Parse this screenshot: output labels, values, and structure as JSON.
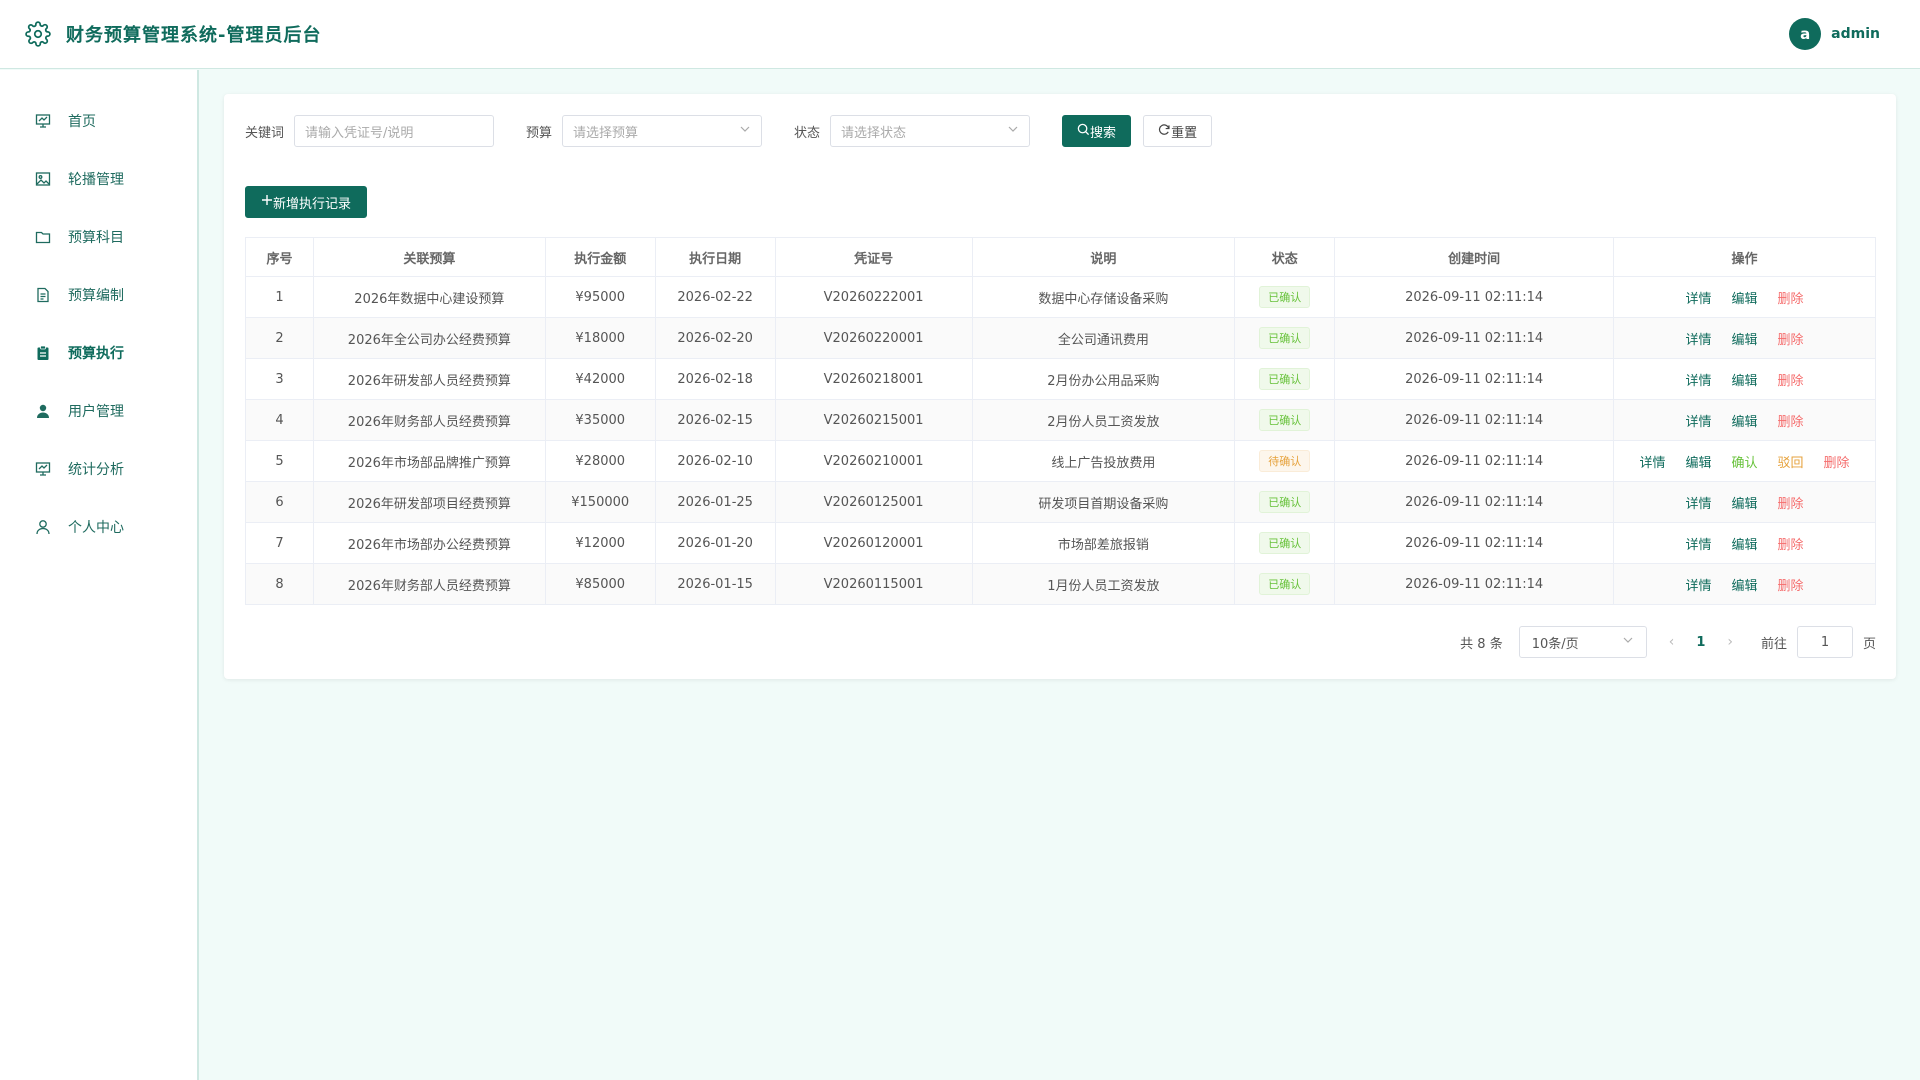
{
  "header": {
    "title": "财务预算管理系统-管理员后台",
    "avatar_letter": "a",
    "username": "admin"
  },
  "sidebar": {
    "items": [
      {
        "label": "首页",
        "icon": "monitor-icon"
      },
      {
        "label": "轮播管理",
        "icon": "image-icon"
      },
      {
        "label": "预算科目",
        "icon": "folder-icon"
      },
      {
        "label": "预算编制",
        "icon": "document-icon"
      },
      {
        "label": "预算执行",
        "icon": "clipboard-icon",
        "active": true
      },
      {
        "label": "用户管理",
        "icon": "user-filled-icon"
      },
      {
        "label": "统计分析",
        "icon": "monitor-icon"
      },
      {
        "label": "个人中心",
        "icon": "user-icon"
      }
    ]
  },
  "filters": {
    "keyword_label": "关键词",
    "keyword_placeholder": "请输入凭证号/说明",
    "budget_label": "预算",
    "budget_placeholder": "请选择预算",
    "status_label": "状态",
    "status_placeholder": "请选择状态",
    "search_label": "搜索",
    "reset_label": "重置"
  },
  "toolbar": {
    "add_label": "新增执行记录"
  },
  "table": {
    "headers": [
      "序号",
      "关联预算",
      "执行金额",
      "执行日期",
      "凭证号",
      "说明",
      "状态",
      "创建时间",
      "操作"
    ],
    "rows": [
      {
        "no": "1",
        "budget": "2026年数据中心建设预算",
        "amount": "¥95000",
        "date": "2026-02-22",
        "voucher": "V20260222001",
        "desc": "数据中心存储设备采购",
        "status": "已确认",
        "created": "2026-09-11 02:11:14",
        "pending": false
      },
      {
        "no": "2",
        "budget": "2026年全公司办公经费预算",
        "amount": "¥18000",
        "date": "2026-02-20",
        "voucher": "V20260220001",
        "desc": "全公司通讯费用",
        "status": "已确认",
        "created": "2026-09-11 02:11:14",
        "pending": false
      },
      {
        "no": "3",
        "budget": "2026年研发部人员经费预算",
        "amount": "¥42000",
        "date": "2026-02-18",
        "voucher": "V20260218001",
        "desc": "2月份办公用品采购",
        "status": "已确认",
        "created": "2026-09-11 02:11:14",
        "pending": false
      },
      {
        "no": "4",
        "budget": "2026年财务部人员经费预算",
        "amount": "¥35000",
        "date": "2026-02-15",
        "voucher": "V20260215001",
        "desc": "2月份人员工资发放",
        "status": "已确认",
        "created": "2026-09-11 02:11:14",
        "pending": false
      },
      {
        "no": "5",
        "budget": "2026年市场部品牌推广预算",
        "amount": "¥28000",
        "date": "2026-02-10",
        "voucher": "V20260210001",
        "desc": "线上广告投放费用",
        "status": "待确认",
        "created": "2026-09-11 02:11:14",
        "pending": true
      },
      {
        "no": "6",
        "budget": "2026年研发部项目经费预算",
        "amount": "¥150000",
        "date": "2026-01-25",
        "voucher": "V20260125001",
        "desc": "研发项目首期设备采购",
        "status": "已确认",
        "created": "2026-09-11 02:11:14",
        "pending": false
      },
      {
        "no": "7",
        "budget": "2026年市场部办公经费预算",
        "amount": "¥12000",
        "date": "2026-01-20",
        "voucher": "V20260120001",
        "desc": "市场部差旅报销",
        "status": "已确认",
        "created": "2026-09-11 02:11:14",
        "pending": false
      },
      {
        "no": "8",
        "budget": "2026年财务部人员经费预算",
        "amount": "¥85000",
        "date": "2026-01-15",
        "voucher": "V20260115001",
        "desc": "1月份人员工资发放",
        "status": "已确认",
        "created": "2026-09-11 02:11:14",
        "pending": false
      }
    ],
    "actions": {
      "detail": "详情",
      "edit": "编辑",
      "confirm": "确认",
      "reject": "驳回",
      "delete": "删除"
    }
  },
  "pagination": {
    "total_text": "共 8 条",
    "page_size": "10条/页",
    "current_page": "1",
    "goto_label": "前往",
    "goto_value": "1",
    "page_suffix": "页"
  },
  "colors": {
    "brand": "#0f6b5c",
    "success": "#67c23a",
    "warning": "#e6a23c",
    "danger": "#f56c6c"
  }
}
